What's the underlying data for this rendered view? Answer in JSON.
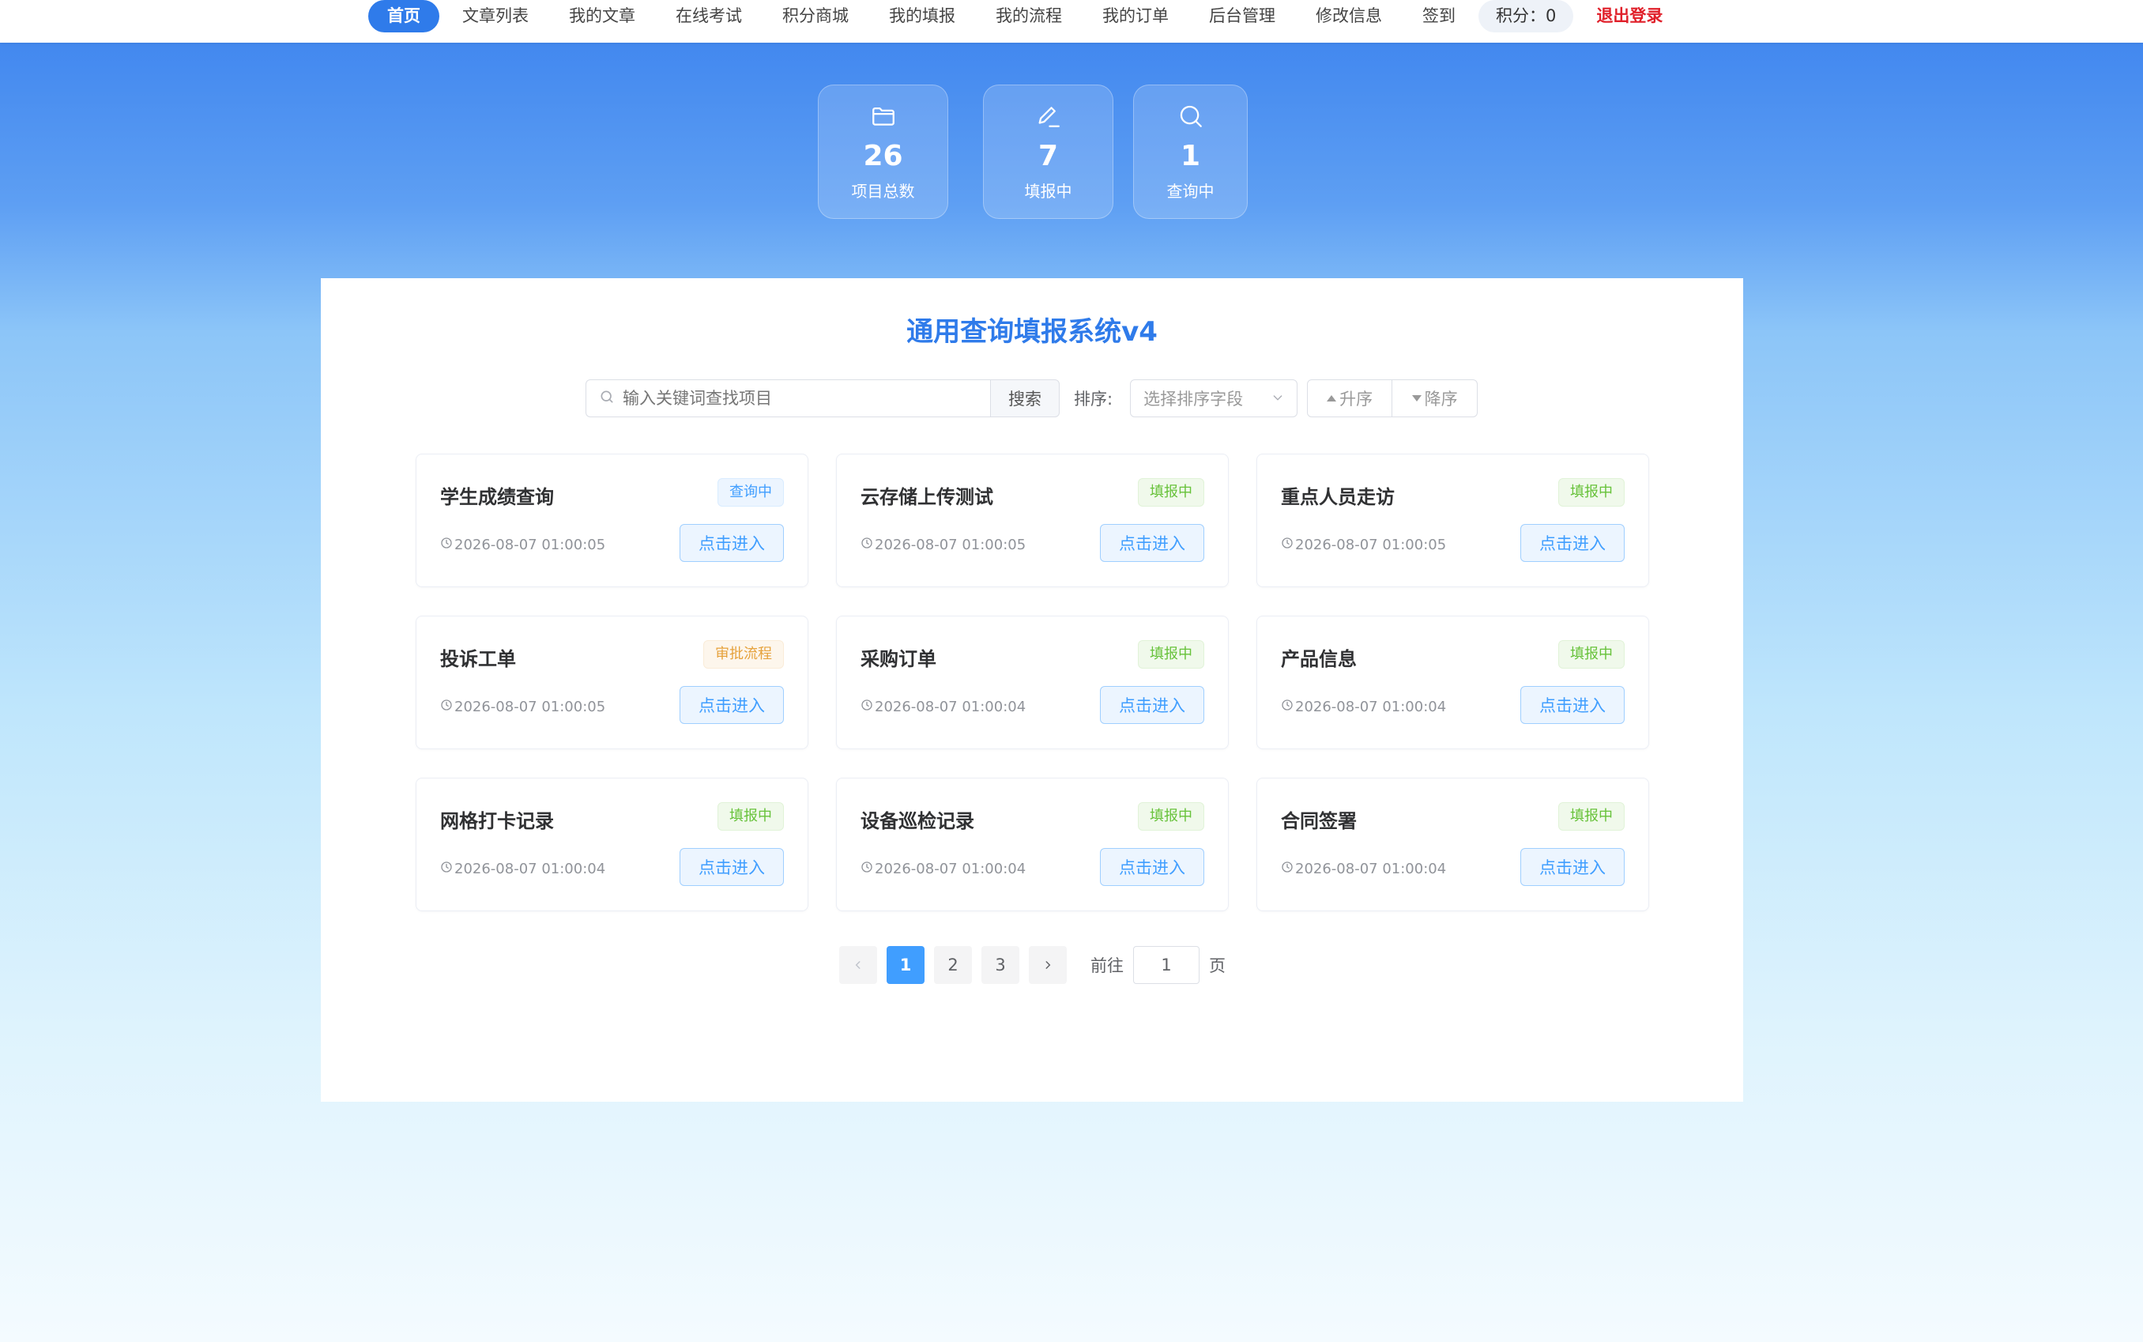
{
  "nav": {
    "items": [
      "首页",
      "文章列表",
      "我的文章",
      "在线考试",
      "积分商城",
      "我的填报",
      "我的流程",
      "我的订单",
      "后台管理",
      "修改信息",
      "签到"
    ],
    "active_index": 0,
    "points": "积分：0",
    "logout": "退出登录"
  },
  "stats": [
    {
      "icon": "folder-icon",
      "value": "26",
      "label": "项目总数"
    },
    {
      "icon": "edit-icon",
      "value": "7",
      "label": "填报中"
    },
    {
      "icon": "search-icon",
      "value": "1",
      "label": "查询中"
    }
  ],
  "main": {
    "title": "通用查询填报系统v4",
    "search_placeholder": "输入关键词查找项目",
    "search_button": "搜索",
    "sort_label": "排序:",
    "sort_select_placeholder": "选择排序字段",
    "asc_label": "升序",
    "desc_label": "降序"
  },
  "cards": [
    {
      "title": "学生成绩查询",
      "tag": "查询中",
      "tag_type": "query",
      "time": "2026-08-07 01:00:05",
      "button": "点击进入"
    },
    {
      "title": "云存储上传测试",
      "tag": "填报中",
      "tag_type": "fill",
      "time": "2026-08-07 01:00:05",
      "button": "点击进入"
    },
    {
      "title": "重点人员走访",
      "tag": "填报中",
      "tag_type": "fill",
      "time": "2026-08-07 01:00:05",
      "button": "点击进入"
    },
    {
      "title": "投诉工单",
      "tag": "审批流程",
      "tag_type": "flow",
      "time": "2026-08-07 01:00:05",
      "button": "点击进入"
    },
    {
      "title": "采购订单",
      "tag": "填报中",
      "tag_type": "fill",
      "time": "2026-08-07 01:00:04",
      "button": "点击进入"
    },
    {
      "title": "产品信息",
      "tag": "填报中",
      "tag_type": "fill",
      "time": "2026-08-07 01:00:04",
      "button": "点击进入"
    },
    {
      "title": "网格打卡记录",
      "tag": "填报中",
      "tag_type": "fill",
      "time": "2026-08-07 01:00:04",
      "button": "点击进入"
    },
    {
      "title": "设备巡检记录",
      "tag": "填报中",
      "tag_type": "fill",
      "time": "2026-08-07 01:00:04",
      "button": "点击进入"
    },
    {
      "title": "合同签署",
      "tag": "填报中",
      "tag_type": "fill",
      "time": "2026-08-07 01:00:04",
      "button": "点击进入"
    }
  ],
  "pagination": {
    "pages": [
      "1",
      "2",
      "3"
    ],
    "current": "1",
    "goto_label": "前往",
    "goto_value": "1",
    "goto_suffix": "页"
  },
  "colors": {
    "primary": "#2f7bea",
    "accent": "#409eff",
    "success": "#67c23a",
    "warning": "#e6a23c",
    "danger": "#e0202a"
  }
}
